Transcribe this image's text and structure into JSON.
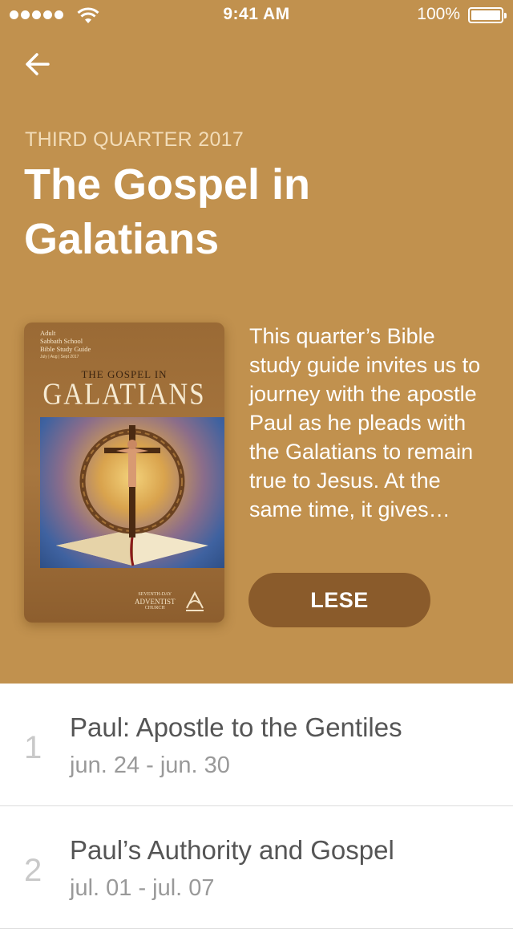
{
  "status_bar": {
    "time": "9:41 AM",
    "battery_percent": "100%"
  },
  "colors": {
    "hero_background": "#c1914e",
    "button_background": "#8a5b2b",
    "accent_text": "#f2dcb8"
  },
  "header": {
    "back_icon": "arrow-left-icon"
  },
  "quarterly": {
    "label": "THIRD QUARTER 2017",
    "title": "The Gospel in Galatians",
    "description": "This quarter’s Bible study guide invites us to journey with the apostle Paul as he pleads with the Galatians to remain true to Jesus. At the same time, it gives…",
    "read_button": "LESE"
  },
  "cover": {
    "line1": "Adult",
    "line2": "Sabbath School",
    "line3": "Bible Study Guide",
    "dates": "July | Aug | Sept 2017",
    "title_small": "THE GOSPEL IN",
    "title_large": "GALATIANS",
    "logo_line1": "SEVENTH-DAY",
    "logo_line2": "ADVENTIST",
    "logo_line3": "CHURCH"
  },
  "lessons": [
    {
      "number": "1",
      "title": "Paul: Apostle to the Gentiles",
      "dates": "jun. 24 - jun. 30"
    },
    {
      "number": "2",
      "title": "Paul’s Authority and Gospel",
      "dates": "jul. 01 - jul. 07"
    }
  ]
}
